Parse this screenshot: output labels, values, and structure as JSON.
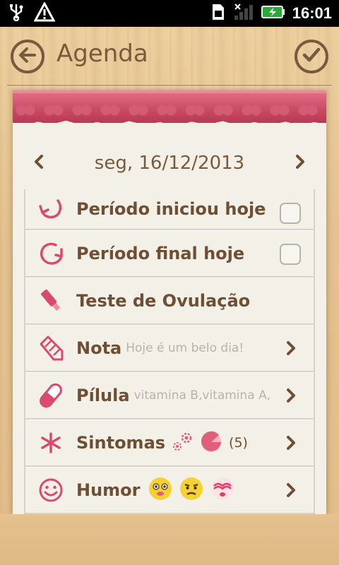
{
  "status_bar": {
    "time": "16:01",
    "icons": [
      "usb-icon",
      "warning-icon",
      "sim-icon",
      "signal-icon",
      "battery-charging-icon"
    ]
  },
  "header": {
    "title": "Agenda",
    "back_icon": "arrow-left-circle-icon",
    "confirm_icon": "check-circle-icon"
  },
  "date_nav": {
    "date": "seg, 16/12/2013",
    "prev_icon": "chevron-left-icon",
    "next_icon": "chevron-right-icon"
  },
  "rows": [
    {
      "label": "Período iniciou hoje",
      "icon": "period-start-icon",
      "control": "checkbox",
      "checked": false
    },
    {
      "label": "Período final hoje",
      "icon": "period-end-icon",
      "control": "checkbox",
      "checked": false
    },
    {
      "label": "Teste de Ovulação",
      "icon": "ovulation-test-icon",
      "control": "none"
    },
    {
      "label": "Nota",
      "sub": "Hoje é um belo dia!",
      "icon": "pencil-icon",
      "control": "chevron"
    },
    {
      "label": "Pílula",
      "sub": "vitamina B,vitamina A,",
      "icon": "pill-icon",
      "control": "chevron"
    },
    {
      "label": "Sintomas",
      "count": "(5)",
      "icon": "asterisk-icon",
      "control": "chevron"
    },
    {
      "label": "Humor",
      "icon": "smiley-icon",
      "control": "chevron"
    }
  ],
  "colors": {
    "accent": "#d94a6e",
    "text_brown": "#6f4f33",
    "fabric_red": "#c94761"
  }
}
